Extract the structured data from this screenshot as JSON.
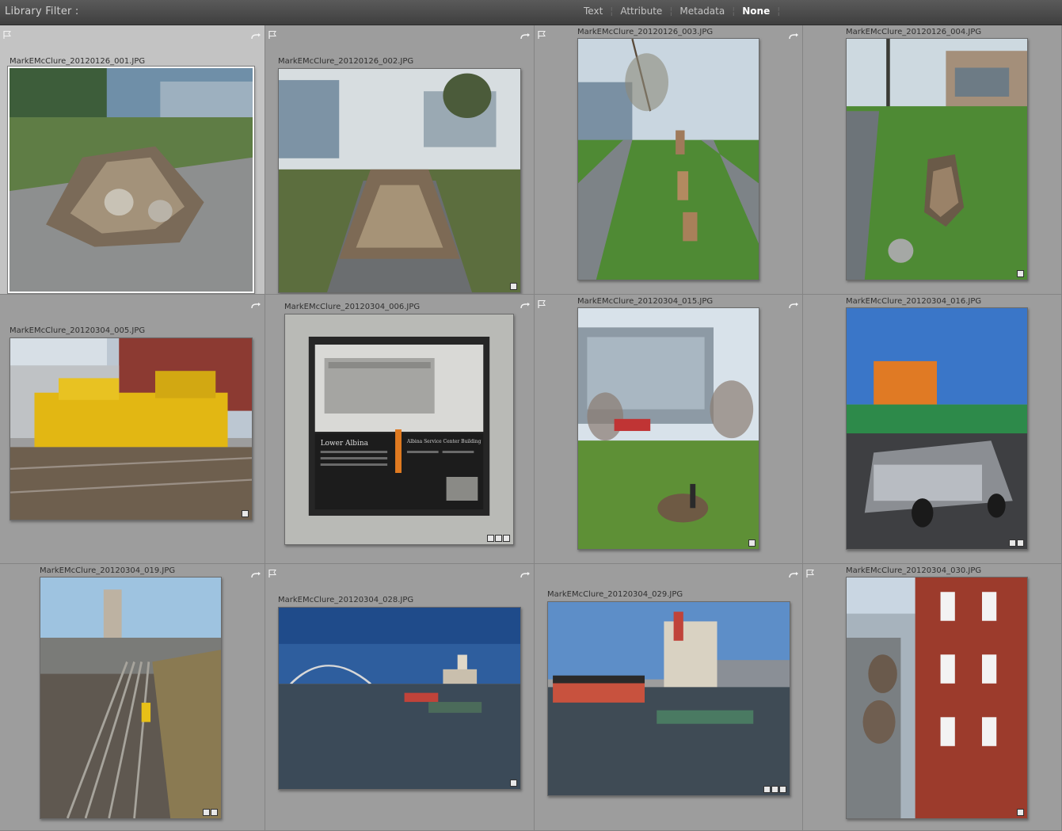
{
  "filter_bar": {
    "title": "Library Filter :",
    "tabs": [
      {
        "label": "Text",
        "active": false
      },
      {
        "label": "Attribute",
        "active": false
      },
      {
        "label": "Metadata",
        "active": false
      },
      {
        "label": "None",
        "active": true
      }
    ]
  },
  "thumbnails": [
    {
      "filename": "MarkEMcClure_20120126_001.JPG",
      "selected": true,
      "flag": true,
      "rotate": true,
      "badges": 0
    },
    {
      "filename": "MarkEMcClure_20120126_002.JPG",
      "selected": false,
      "flag": true,
      "rotate": true,
      "badges": 1
    },
    {
      "filename": "MarkEMcClure_20120126_003.JPG",
      "selected": false,
      "flag": true,
      "rotate": true,
      "badges": 0
    },
    {
      "filename": "MarkEMcClure_20120126_004.JPG",
      "selected": false,
      "flag": false,
      "rotate": false,
      "badges": 1
    },
    {
      "filename": "MarkEMcClure_20120304_005.JPG",
      "selected": false,
      "flag": false,
      "rotate": true,
      "badges": 1
    },
    {
      "filename": "MarkEMcClure_20120304_006.JPG",
      "selected": false,
      "flag": false,
      "rotate": true,
      "badges": 3
    },
    {
      "filename": "MarkEMcClure_20120304_015.JPG",
      "selected": false,
      "flag": true,
      "rotate": true,
      "badges": 1
    },
    {
      "filename": "MarkEMcClure_20120304_016.JPG",
      "selected": false,
      "flag": false,
      "rotate": false,
      "badges": 2
    },
    {
      "filename": "MarkEMcClure_20120304_019.JPG",
      "selected": false,
      "flag": false,
      "rotate": true,
      "badges": 2
    },
    {
      "filename": "MarkEMcClure_20120304_028.JPG",
      "selected": false,
      "flag": true,
      "rotate": true,
      "badges": 1
    },
    {
      "filename": "MarkEMcClure_20120304_029.JPG",
      "selected": false,
      "flag": false,
      "rotate": true,
      "badges": 3
    },
    {
      "filename": "MarkEMcClure_20120304_030.JPG",
      "selected": false,
      "flag": true,
      "rotate": false,
      "badges": 1
    }
  ],
  "sign": {
    "heading": "Lower Albina",
    "subheading": "Albina Service Center Building"
  },
  "icons": {
    "flag": "flag-icon",
    "rotate": "rotate-icon",
    "badge": "metadata-badge-icon"
  },
  "colors": {
    "grid_background": "#9d9d9d",
    "selected_cell": "#c3c3c3",
    "filter_bar": "#474747"
  }
}
